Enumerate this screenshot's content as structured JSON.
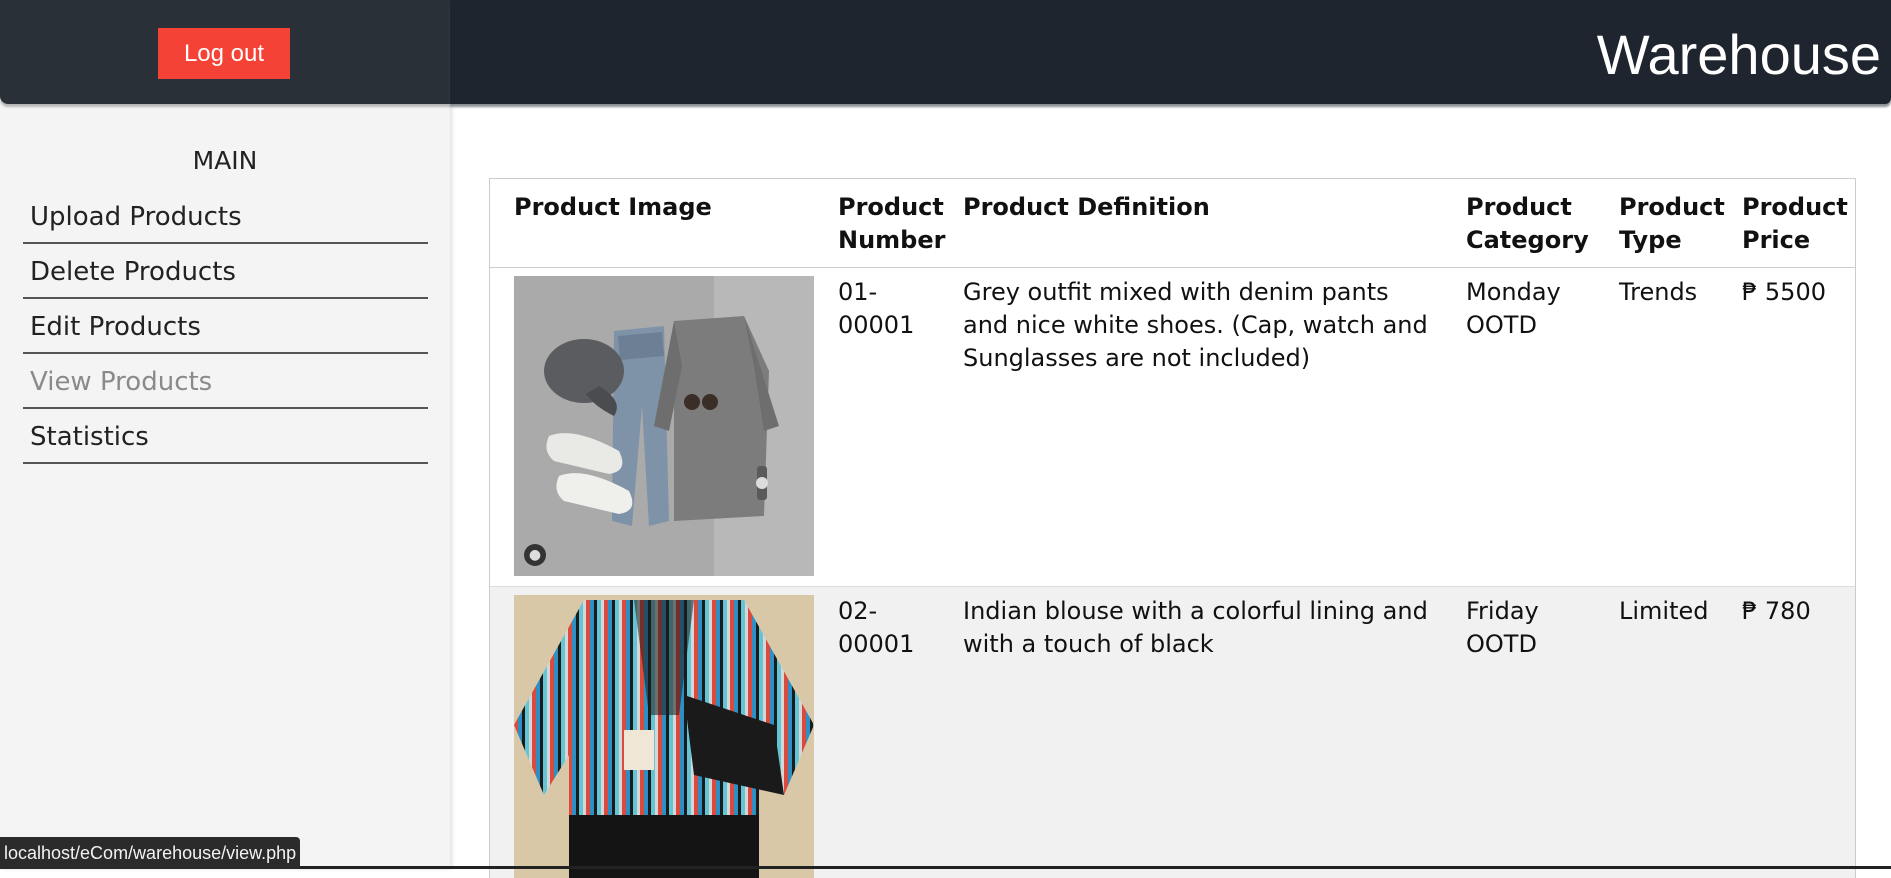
{
  "sidebar": {
    "logout_label": "Log out",
    "heading": "MAIN",
    "items": [
      {
        "label": "Upload Products"
      },
      {
        "label": "Delete Products"
      },
      {
        "label": "Edit Products"
      },
      {
        "label": "View Products"
      },
      {
        "label": "Statistics"
      }
    ],
    "active_item": "View Products"
  },
  "header": {
    "title": "Warehouse"
  },
  "table": {
    "columns": [
      "Product Image",
      "Product Number",
      "Product Definition",
      "Product Category",
      "Product Type",
      "Product Price"
    ],
    "rows": [
      {
        "image": "grey-outfit-photo",
        "number": "01-00001",
        "definition": "Grey outfit mixed with denim pants and nice white shoes. (Cap, watch and Sunglasses are not included)",
        "category": "Monday OOTD",
        "type": "Trends",
        "price": "₱ 5500"
      },
      {
        "image": "indian-blouse-photo",
        "number": "02-00001",
        "definition": "Indian blouse with a colorful lining and with a touch of black",
        "category": "Friday OOTD",
        "type": "Limited",
        "price": "₱ 780"
      }
    ]
  },
  "statusbar": {
    "url": "localhost/eCom/warehouse/view.php"
  },
  "colors": {
    "logout": "#f44336",
    "header": "#1e252e",
    "sidebar": "#f4f4f4"
  }
}
